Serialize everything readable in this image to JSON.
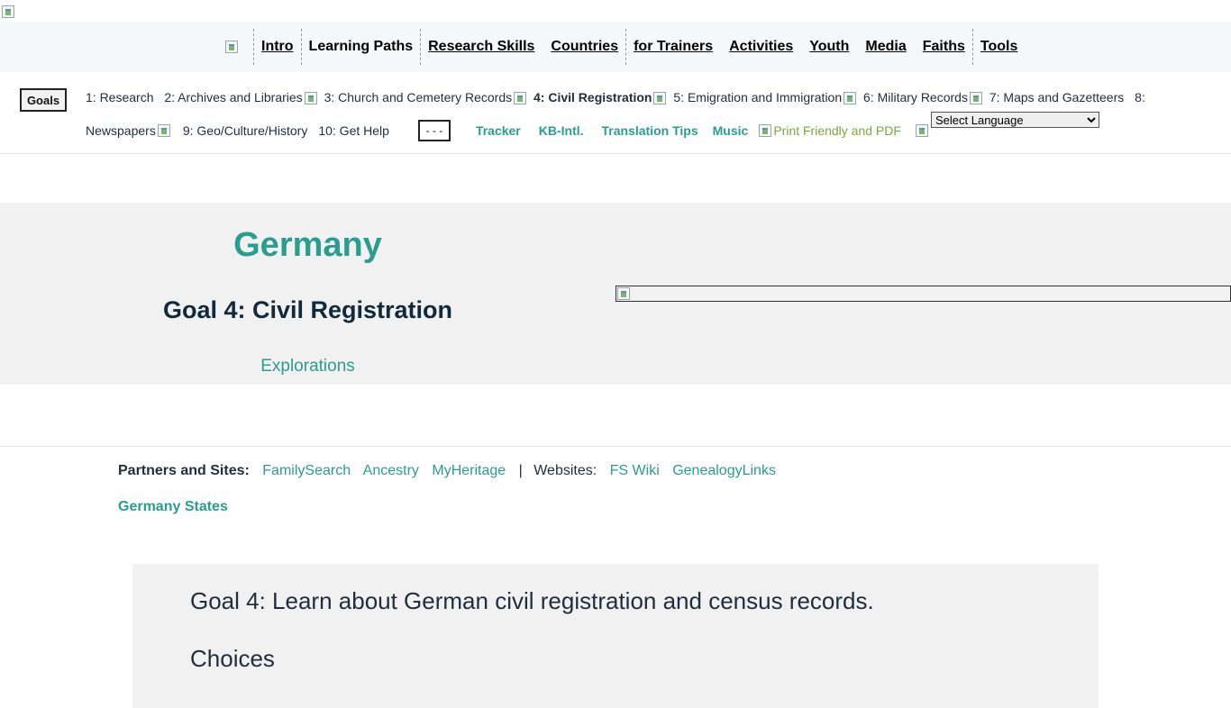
{
  "nav": {
    "items": [
      {
        "label": "Intro",
        "underline": true
      },
      {
        "label": "Learning Paths",
        "underline": false
      },
      {
        "label": "Research Skills",
        "underline": true
      },
      {
        "label": "Countries",
        "underline": true
      },
      {
        "label": "for Trainers",
        "underline": true
      },
      {
        "label": "Activities",
        "underline": true
      },
      {
        "label": "Youth",
        "underline": true
      },
      {
        "label": "Media",
        "underline": true
      },
      {
        "label": "Faiths",
        "underline": true
      },
      {
        "label": "Tools",
        "underline": true
      }
    ]
  },
  "goals": {
    "button_label": "Goals",
    "g1": "1: Research",
    "g2": "2: Archives and Libraries",
    "g3": "3: Church and Cemetery Records",
    "g4": "4: Civil Registration",
    "g5": "5: Emigration and Immigration",
    "g6": "6: Military Records",
    "g7": "7: Maps and Gazetteers",
    "g8a": "8:",
    "g8b": "Newspapers",
    "g9": "9: Geo/Culture/History",
    "g10": "10: Get Help",
    "dash_label": "- - -",
    "tracker": "Tracker",
    "kb_intl": "KB-Intl.",
    "translation_tips": "Translation Tips",
    "music": "Music",
    "print_pdf": "Print Friendly and PDF",
    "language_select": "Select Language"
  },
  "hero": {
    "title": "Germany",
    "subtitle": "Goal 4: Civil Registration",
    "link": "Explorations"
  },
  "partners": {
    "label": "Partners and Sites:",
    "familysearch": "FamilySearch",
    "ancestry": "Ancestry",
    "myheritage": "MyHeritage",
    "pipe": "|",
    "websites_label": "Websites:",
    "fs_wiki": "FS Wiki",
    "genealogylinks": "GenealogyLinks",
    "germany_states": "Germany States"
  },
  "content": {
    "goal_statement": "Goal 4: Learn about German civil registration and census records.",
    "choices": "Choices"
  },
  "colors": {
    "accent": "#2a9d8f",
    "dark_heading": "#102a3c",
    "print_link": "#79a83b",
    "hero_bg": "#f1f1f1",
    "nav_bg": "#f5f8fa"
  }
}
